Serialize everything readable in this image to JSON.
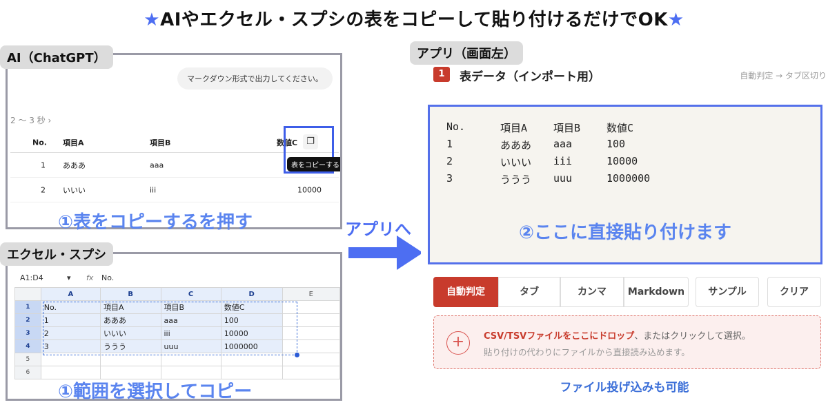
{
  "headline": {
    "star_left": "★",
    "text": "AIやエクセル・スプシの表をコピーして貼り付けるだけでOK",
    "star_right": "★"
  },
  "ai": {
    "tag": "AI（ChatGPT）",
    "bubble": "マークダウン形式で出力してください。",
    "thinking": "2 〜 3 秒 ›",
    "table": {
      "headers": [
        "No.",
        "項目A",
        "項目B",
        "数値C"
      ],
      "rows": [
        [
          "1",
          "あああ",
          "aaa",
          ""
        ],
        [
          "2",
          "いいい",
          "iii",
          "10000"
        ]
      ]
    },
    "copy_icon": "copy-icon",
    "tooltip": "表をコピーする",
    "caption": "①表をコピーするを押す"
  },
  "excel": {
    "tag": "エクセル・スプシ",
    "name_box": "A1:D4",
    "name_arrow": "▾",
    "fx": "fx",
    "formula": "No.",
    "columns": [
      "A",
      "B",
      "C",
      "D",
      "E"
    ],
    "row_numbers": [
      "1",
      "2",
      "3",
      "4",
      "5",
      "6"
    ],
    "cells": [
      [
        "No.",
        "項目A",
        "項目B",
        "数値C"
      ],
      [
        "1",
        "あああ",
        "aaa",
        "100"
      ],
      [
        "2",
        "いいい",
        "iii",
        "10000"
      ],
      [
        "3",
        "ううう",
        "uuu",
        "1000000"
      ]
    ],
    "caption": "①範囲を選択してコピー"
  },
  "arrow_label": "アプリへ",
  "app": {
    "tag": "アプリ（画面左）",
    "section_number": "1",
    "section_title": "表データ（インポート用）",
    "section_hint": "自動判定 → タブ区切り",
    "textarea": [
      [
        "No.",
        "項目A",
        "項目B",
        "数値C"
      ],
      [
        "1",
        "あああ",
        "aaa",
        "100"
      ],
      [
        "2",
        "いいい",
        "iii",
        "10000"
      ],
      [
        "3",
        "ううう",
        "uuu",
        "1000000"
      ]
    ],
    "paste_caption": "②ここに直接貼り付けます",
    "buttons": [
      "自動判定",
      "タブ",
      "カンマ",
      "Markdown",
      "サンプル",
      "クリア"
    ],
    "drop": {
      "plus": "+",
      "strong": "CSV/TSVファイルをここにドロップ",
      "rest": "、またはクリックして選択。",
      "line2": "貼り付けの代わりにファイルから直接読み込めます。"
    },
    "file_caption": "ファイル投げ込みも可能"
  },
  "colors": {
    "accent": "#4d6ef2",
    "caption_blue": "#5a84ef",
    "red": "#c83b2c",
    "panel_border": "#9a9aa6"
  }
}
